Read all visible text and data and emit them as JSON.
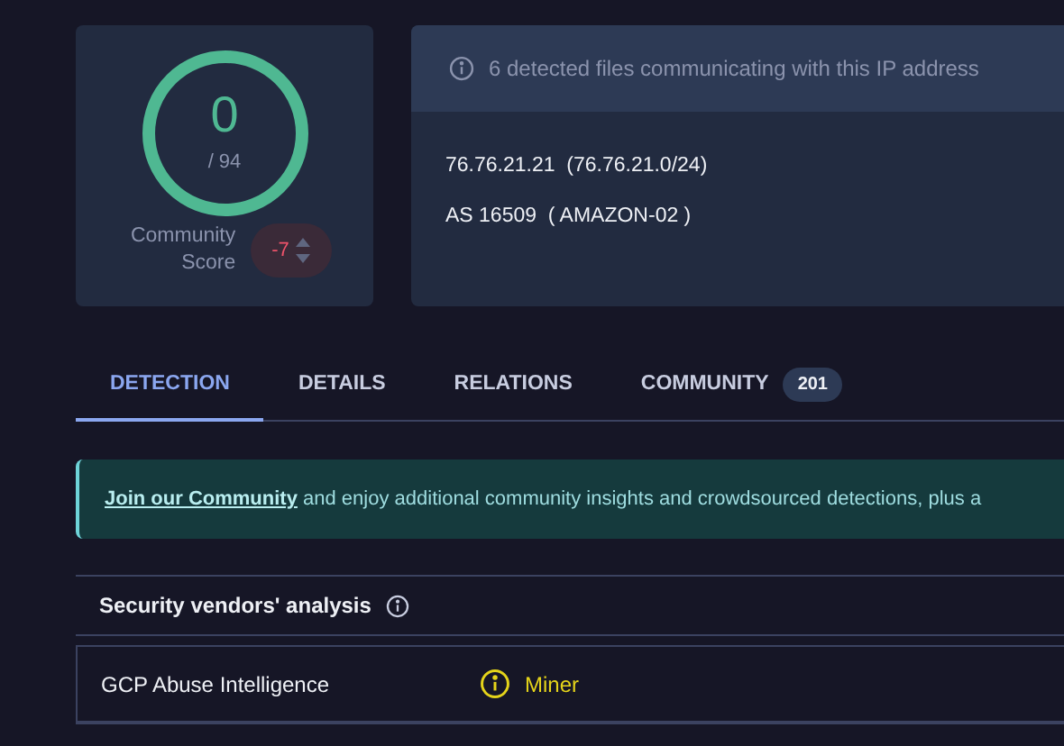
{
  "score": {
    "value": "0",
    "total": "/ 94",
    "label": "Community Score",
    "vote": "-7"
  },
  "info": {
    "banner": "6 detected files communicating with this IP address",
    "lines": [
      "76.76.21.21  (76.76.21.0/24)",
      "AS 16509  ( AMAZON-02 )"
    ]
  },
  "tabs": [
    {
      "label": "DETECTION",
      "selected": true
    },
    {
      "label": "DETAILS",
      "selected": false
    },
    {
      "label": "RELATIONS",
      "selected": false
    },
    {
      "label": "COMMUNITY",
      "selected": false,
      "count": "201"
    }
  ],
  "promo": {
    "link": "Join our Community",
    "text": "and enjoy additional community insights and crowdsourced detections, plus a"
  },
  "vendors": {
    "title": "Security vendors' analysis",
    "rows": [
      {
        "name": "GCP Abuse Intelligence",
        "result": "Miner",
        "kind": "suspicious"
      }
    ]
  }
}
